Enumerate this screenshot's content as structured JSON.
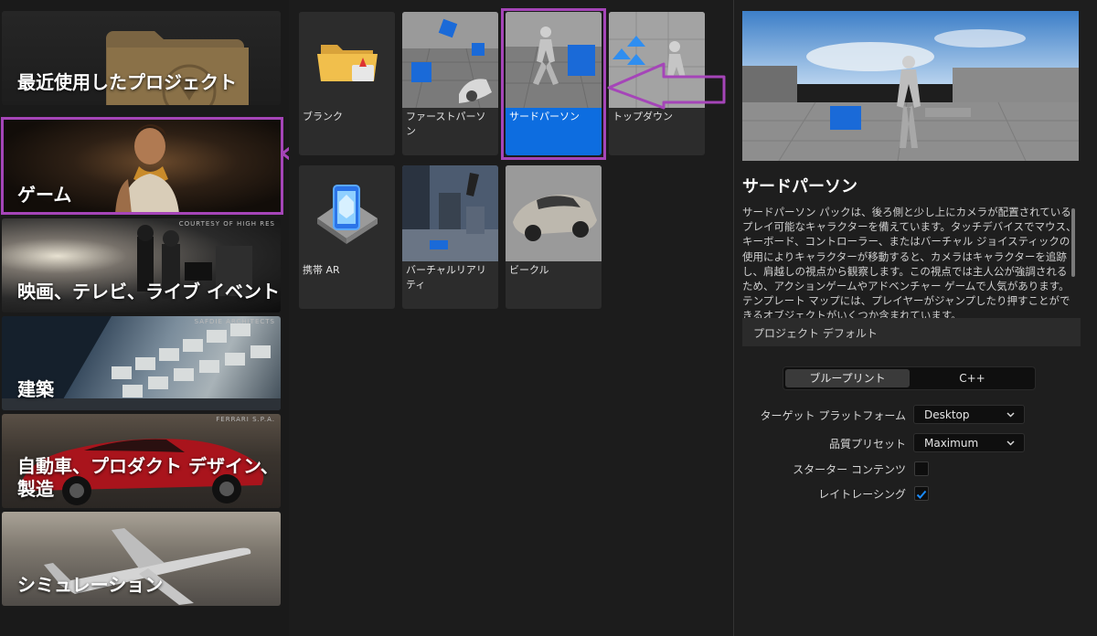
{
  "categories": [
    {
      "id": "recent",
      "label": "最近使用したプロジェクト",
      "credit": ""
    },
    {
      "id": "game",
      "label": "ゲーム",
      "credit": "",
      "selected": true
    },
    {
      "id": "film",
      "label": "映画、テレビ、ライブ イベント",
      "credit": "COURTESY OF HIGH RES"
    },
    {
      "id": "arch",
      "label": "建築",
      "credit": "SAFDIE ARCHITECTS"
    },
    {
      "id": "auto",
      "label": "自動車、プロダクト デザイン、製造",
      "credit": "FERRARI S.P.A."
    },
    {
      "id": "sim",
      "label": "シミュレーション",
      "credit": ""
    }
  ],
  "templates": [
    {
      "label": "ブランク",
      "icon": "folder-icon"
    },
    {
      "label": "ファーストパーソン",
      "icon": "first-person-thumb"
    },
    {
      "label": "サードパーソン",
      "icon": "third-person-thumb",
      "selected": true
    },
    {
      "label": "トップダウン",
      "icon": "top-down-thumb"
    },
    {
      "label": "携帯 AR",
      "icon": "mobile-ar-icon"
    },
    {
      "label": "バーチャルリアリティ",
      "icon": "vr-thumb"
    },
    {
      "label": "ビークル",
      "icon": "vehicle-thumb"
    }
  ],
  "details": {
    "title": "サードパーソン",
    "description": "サードパーソン パックは、後ろ側と少し上にカメラが配置されているプレイ可能なキャラクターを備えています。タッチデバイスでマウス、キーボード、コントローラー、またはバーチャル ジョイスティックの使用によりキャラクターが移動すると、カメラはキャラクターを追跡し、肩越しの視点から観察します。この視点では主人公が強調されるため、アクションゲームやアドベンチャー ゲームで人気があります。テンプレート マップには、プレイヤーがジャンプしたり押すことができるオブジェクトがいくつか含まれています。",
    "defaults_header": "プロジェクト デフォルト",
    "mode_blueprint": "ブループリント",
    "mode_cpp": "C++",
    "target_platform_label": "ターゲット プラットフォーム",
    "target_platform_value": "Desktop",
    "quality_label": "品質プリセット",
    "quality_value": "Maximum",
    "starter_label": "スターター コンテンツ",
    "starter_checked": false,
    "raytracing_label": "レイトレーシング",
    "raytracing_checked": true
  },
  "colors": {
    "selection_blue": "#0d6de0",
    "annotation_purple": "#a545b8",
    "check_blue": "#1a8cff"
  }
}
